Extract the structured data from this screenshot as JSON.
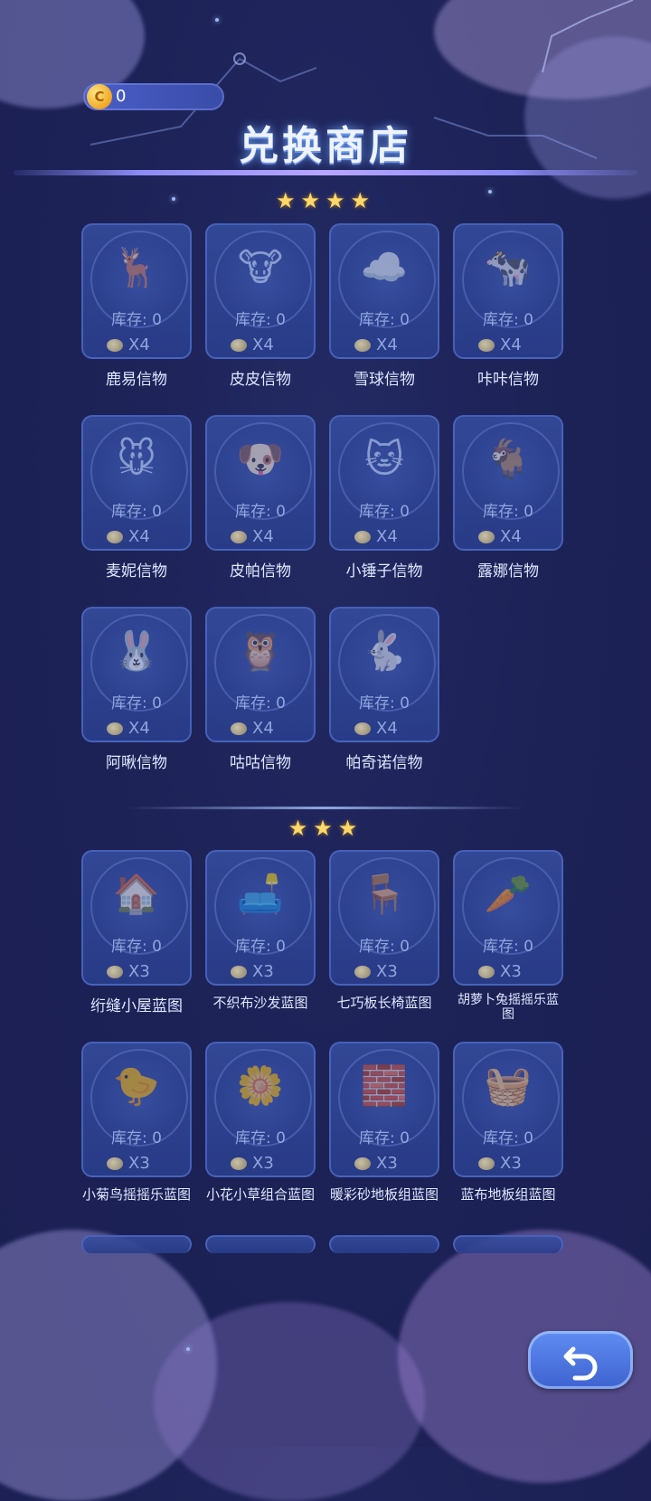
{
  "header": {
    "coin_count": "0",
    "coin_glyph": "C",
    "title": "兑换商店"
  },
  "sections": [
    {
      "stars": "★★★★",
      "items": [
        {
          "name": "鹿易信物",
          "stock": "库存: 0",
          "cost": "X4",
          "art": "🦌"
        },
        {
          "name": "皮皮信物",
          "stock": "库存: 0",
          "cost": "X4",
          "art": "🐮"
        },
        {
          "name": "雪球信物",
          "stock": "库存: 0",
          "cost": "X4",
          "art": "☁️"
        },
        {
          "name": "咔咔信物",
          "stock": "库存: 0",
          "cost": "X4",
          "art": "🐄"
        },
        {
          "name": "麦妮信物",
          "stock": "库存: 0",
          "cost": "X4",
          "art": "🐭"
        },
        {
          "name": "皮帕信物",
          "stock": "库存: 0",
          "cost": "X4",
          "art": "🐶"
        },
        {
          "name": "小锤子信物",
          "stock": "库存: 0",
          "cost": "X4",
          "art": "🐱"
        },
        {
          "name": "露娜信物",
          "stock": "库存: 0",
          "cost": "X4",
          "art": "🐐"
        },
        {
          "name": "阿啾信物",
          "stock": "库存: 0",
          "cost": "X4",
          "art": "🐰"
        },
        {
          "name": "咕咕信物",
          "stock": "库存: 0",
          "cost": "X4",
          "art": "🦉"
        },
        {
          "name": "帕奇诺信物",
          "stock": "库存: 0",
          "cost": "X4",
          "art": "🐇"
        }
      ]
    },
    {
      "stars": "★★★",
      "items": [
        {
          "name": "绗缝小屋蓝图",
          "stock": "库存: 0",
          "cost": "X3",
          "art": "🏠"
        },
        {
          "name": "不织布沙发蓝图",
          "stock": "库存: 0",
          "cost": "X3",
          "art": "🛋️"
        },
        {
          "name": "七巧板长椅蓝图",
          "stock": "库存: 0",
          "cost": "X3",
          "art": "🪑"
        },
        {
          "name": "胡萝卜兔摇摇乐蓝图",
          "stock": "库存: 0",
          "cost": "X3",
          "art": "🥕"
        },
        {
          "name": "小菊鸟摇摇乐蓝图",
          "stock": "库存: 0",
          "cost": "X3",
          "art": "🐤"
        },
        {
          "name": "小花小草组合蓝图",
          "stock": "库存: 0",
          "cost": "X3",
          "art": "🌼"
        },
        {
          "name": "暖彩砂地板组蓝图",
          "stock": "库存: 0",
          "cost": "X3",
          "art": "🧱"
        },
        {
          "name": "蓝布地板组蓝图",
          "stock": "库存: 0",
          "cost": "X3",
          "art": "🧺"
        }
      ]
    }
  ]
}
